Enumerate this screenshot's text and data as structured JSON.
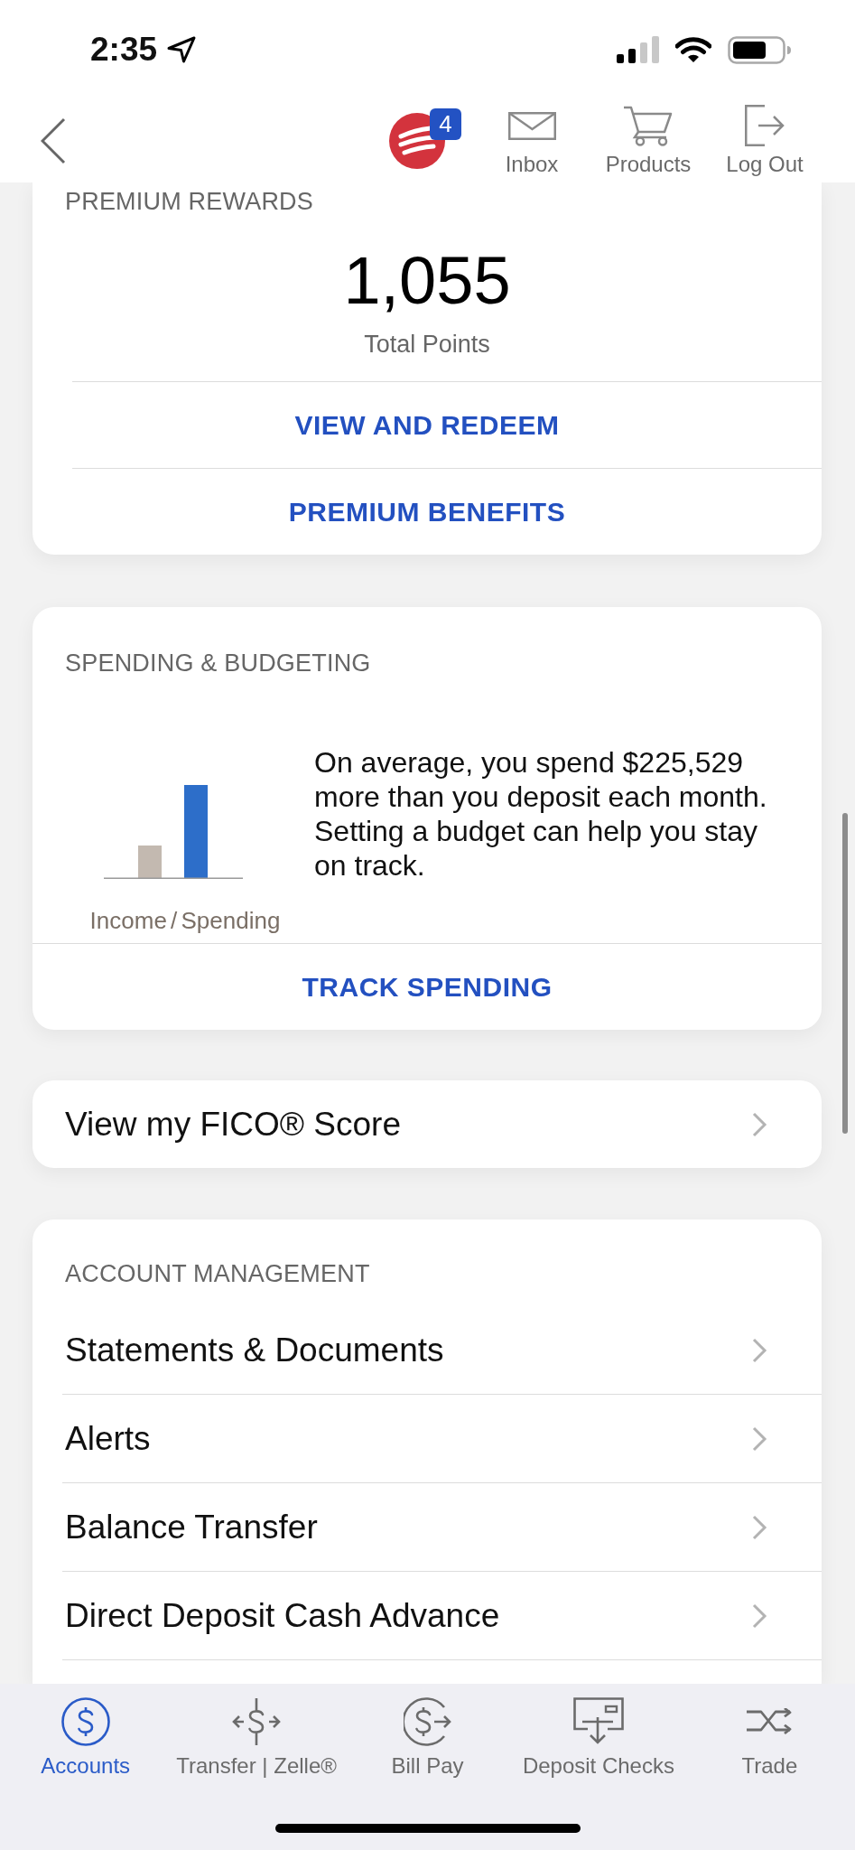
{
  "status_bar": {
    "time": "2:35"
  },
  "nav": {
    "badge": "4",
    "actions": [
      {
        "kind": "inbox",
        "label": "Inbox"
      },
      {
        "kind": "products",
        "label": "Products"
      },
      {
        "kind": "logout",
        "label": "Log Out"
      }
    ]
  },
  "rewards": {
    "heading": "PREMIUM REWARDS",
    "points": "1,055",
    "points_label": "Total Points",
    "links": [
      "VIEW AND REDEEM",
      "PREMIUM BENEFITS"
    ]
  },
  "spending": {
    "heading": "SPENDING & BUDGETING",
    "chart_caption": "Income / Spending",
    "message": "On average, you spend $225,529 more than you deposit each month. Setting a budget can help you stay on track.",
    "link": "TRACK SPENDING"
  },
  "fico": {
    "label": "View my FICO® Score"
  },
  "account_management": {
    "heading": "ACCOUNT MANAGEMENT",
    "items": [
      "Statements & Documents",
      "Alerts",
      "Balance Transfer",
      "Direct Deposit Cash Advance"
    ]
  },
  "tab_bar": {
    "tabs": [
      {
        "kind": "accounts",
        "label": "Accounts",
        "selected": true
      },
      {
        "kind": "transfer",
        "label": "Transfer | Zelle®",
        "selected": false
      },
      {
        "kind": "billpay",
        "label": "Bill Pay",
        "selected": false
      },
      {
        "kind": "deposit",
        "label": "Deposit Checks",
        "selected": false
      },
      {
        "kind": "trade",
        "label": "Trade",
        "selected": false
      }
    ]
  }
}
